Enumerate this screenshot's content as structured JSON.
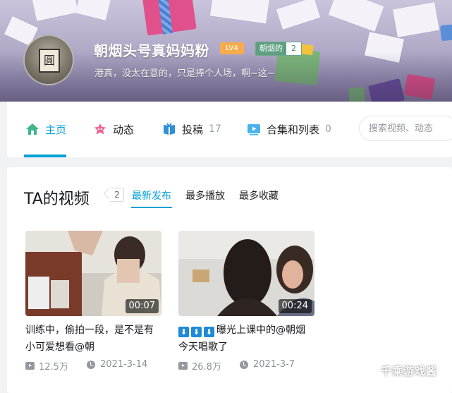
{
  "profile": {
    "username": "朝烟头号真妈妈粉",
    "level": "LV4",
    "medal_name": "朝烟的",
    "medal_level": "2",
    "signature": "港真，没太在意的，只是捧个人场，啊~这~"
  },
  "nav": {
    "items": [
      {
        "label": "主页",
        "icon": "home-icon",
        "count": ""
      },
      {
        "label": "动态",
        "icon": "dynamic-icon",
        "count": ""
      },
      {
        "label": "投稿",
        "icon": "upload-icon",
        "count": "17"
      },
      {
        "label": "合集和列表",
        "icon": "collection-icon",
        "count": "0"
      }
    ],
    "active": "主页",
    "search_placeholder": "搜索视频、动态"
  },
  "videos_section": {
    "title": "TA的视频",
    "count": "2",
    "sort_options": [
      "最新发布",
      "最多播放",
      "最多收藏"
    ],
    "active_sort": "最新发布",
    "items": [
      {
        "duration": "00:07",
        "title": "训练中，偷拍一段，是不是有小可爱想看@朝",
        "title_prefix_arrows": 0,
        "plays": "12.5万",
        "date": "2021-3-14"
      },
      {
        "duration": "00:24",
        "title_arrows": "⬇⬇⬇",
        "title": "曝光上课中的@朝烟今天唱歌了",
        "plays": "26.8万",
        "date": "2021-3-7"
      }
    ]
  },
  "watermark": "千乘游戏酱",
  "colors": {
    "accent": "#00a1d6",
    "level_badge": "#f7ac4b",
    "medal": "#5e9f82"
  }
}
